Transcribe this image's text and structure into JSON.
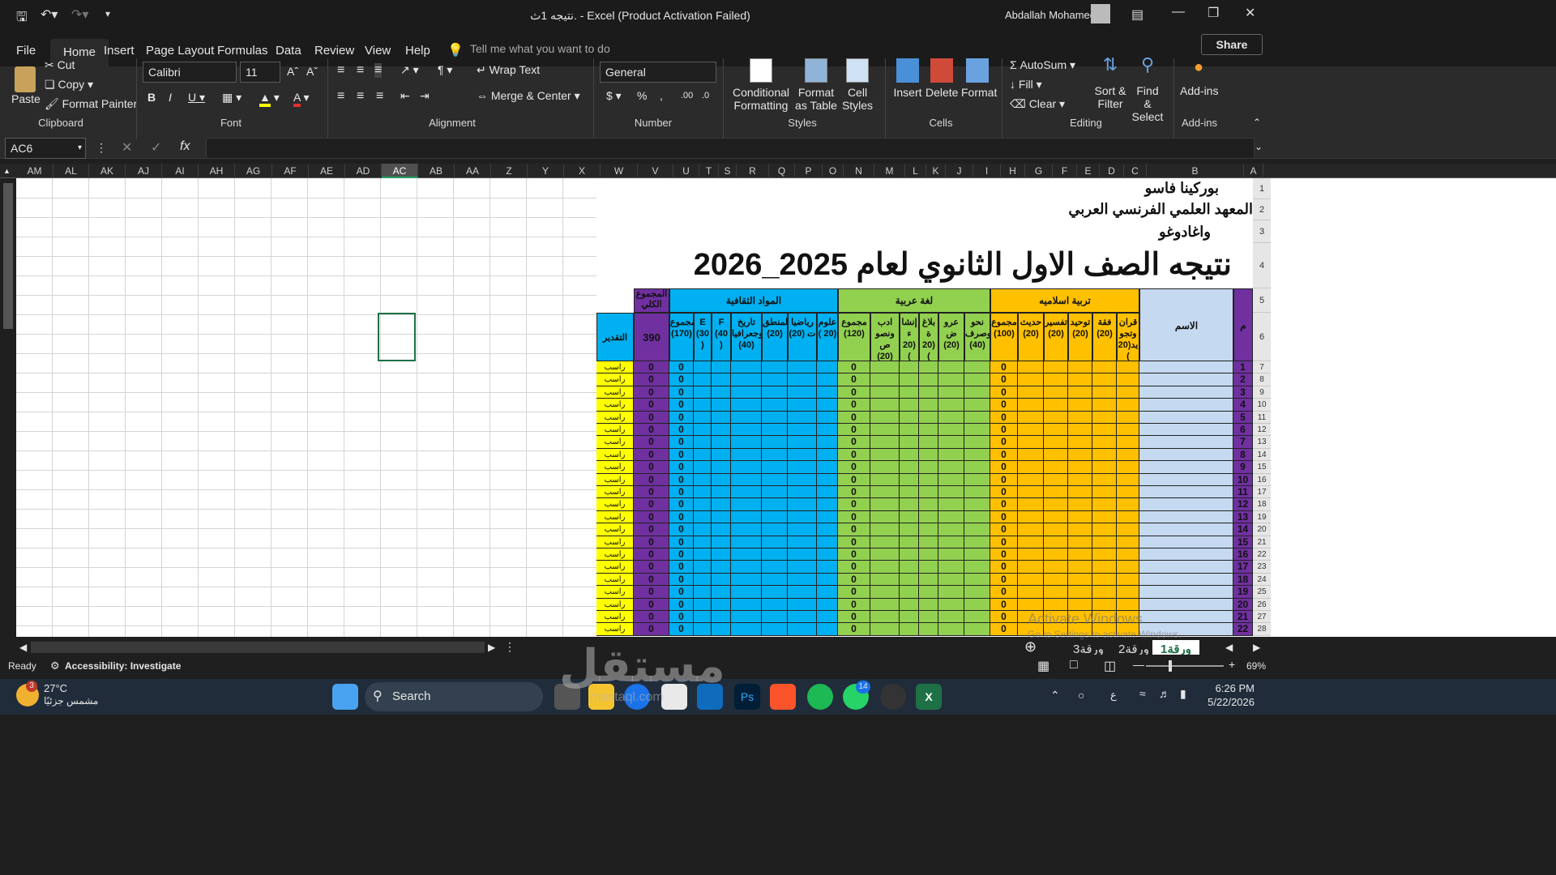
{
  "window": {
    "title": "نتيجه 1ث.  -  Excel (Product Activation Failed)",
    "user": "Abdallah Mohamed"
  },
  "tabs": [
    "File",
    "Home",
    "Insert",
    "Page Layout",
    "Formulas",
    "Data",
    "Review",
    "View",
    "Help"
  ],
  "tell_me": "Tell me what you want to do",
  "share": "Share",
  "ribbon": {
    "clipboard": {
      "paste": "Paste",
      "cut": "Cut",
      "copy": "Copy",
      "format_painter": "Format Painter",
      "label": "Clipboard"
    },
    "font": {
      "name": "Calibri",
      "size": "11",
      "label": "Font"
    },
    "alignment": {
      "wrap": "Wrap Text",
      "merge": "Merge & Center",
      "label": "Alignment"
    },
    "number": {
      "format": "General",
      "label": "Number"
    },
    "styles": {
      "conditional": "Conditional Formatting",
      "format_table": "Format as Table",
      "cell_styles": "Cell Styles",
      "label": "Styles"
    },
    "cells": {
      "insert": "Insert",
      "delete": "Delete",
      "format": "Format",
      "label": "Cells"
    },
    "editing": {
      "autosum": "AutoSum",
      "fill": "Fill",
      "clear": "Clear",
      "sort": "Sort & Filter",
      "find": "Find & Select",
      "label": "Editing"
    },
    "addins": {
      "addins": "Add-ins",
      "label": "Add-ins"
    }
  },
  "namebox": "AC6",
  "columns": [
    "AM",
    "AL",
    "AK",
    "AJ",
    "AI",
    "AH",
    "AG",
    "AF",
    "AE",
    "AD",
    "AC",
    "AB",
    "AA",
    "Z",
    "Y",
    "X",
    "W",
    "V",
    "U",
    "T",
    "S",
    "R",
    "Q",
    "P",
    "O",
    "N",
    "M",
    "L",
    "K",
    "J",
    "I",
    "H",
    "G",
    "F",
    "E",
    "D",
    "C",
    "B",
    "A"
  ],
  "sheet": {
    "line1": "بوركينا فاسو",
    "line2": "المعهد العلمي الفرنسي العربي",
    "line3": "واغادوغو",
    "title": "نتيجه الصف الاول الثانوي لعام 2025_2026",
    "col_m": "م",
    "col_name": "الاسم",
    "group_islamic": "تربية اسلاميه",
    "group_arabic": "لغة عربية",
    "group_culture": "المواد الثقافية",
    "total_all": "المجموع الكلي",
    "total_all_value": "390",
    "grade": "التقدير",
    "islamic_subjects": [
      "قران وتجو يد(20 )",
      "فقة (20)",
      "توحيد (20)",
      "تفسير (20)",
      "حديث (20)",
      "مجموع (100)"
    ],
    "arabic_subjects": [
      "نحو وصرف (40)",
      "عرو ض (20)",
      "بلاغ ة (20 )",
      "إنشا ء (20 )",
      "ادب ونصو ص (20)",
      "مجموع (120)"
    ],
    "culture_subjects": [
      "علوم (20 )",
      "رياضيا ت (20)",
      "المنطق (20)",
      "تاريخ وجعرافيا (40)",
      "F (40 )",
      "E (30 )",
      "مجموع (170)"
    ],
    "grade_value": "راسب",
    "zero": "0"
  },
  "watermark": {
    "line1": "Activate Windows",
    "line2": "Go to Settings to activate Windows."
  },
  "sheets": [
    "ورقة1",
    "ورقة2",
    "ورقة3"
  ],
  "status": {
    "ready": "Ready",
    "accessibility": "Accessibility: Investigate",
    "zoom": "69%"
  },
  "taskbar": {
    "temp": "27°C",
    "weather": "مشمس جزئيًا",
    "search": "Search",
    "time": "6:26 PM",
    "date": "5/22/2026",
    "lang": "ع",
    "badge_whatsapp": "14",
    "badge_weather": "3"
  },
  "logo": {
    "text": "مستقل",
    "sub": "mostaql.com"
  }
}
